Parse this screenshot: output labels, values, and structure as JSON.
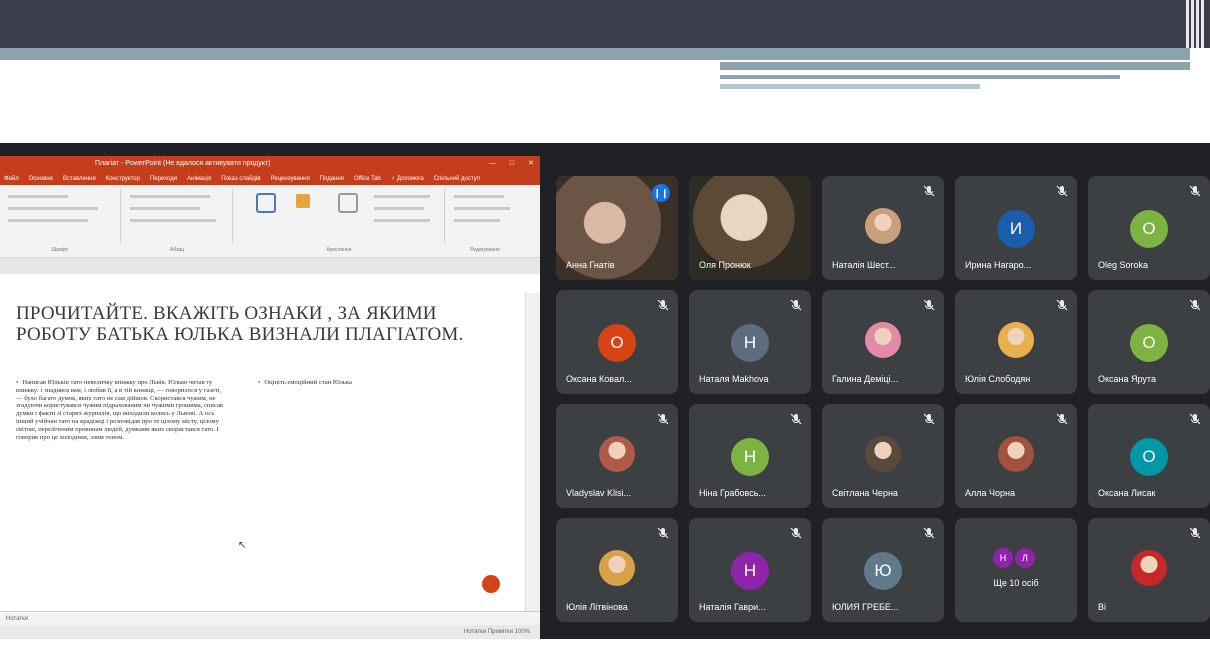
{
  "ppt": {
    "window_title": "Плагіат - PowerPoint (Не вдалося активувати продукт)",
    "tabs": [
      "Файл",
      "Основне",
      "Вставлення",
      "Конструктор",
      "Переходи",
      "Анімація",
      "Показ слайдів",
      "Рецензування",
      "Подання",
      "Office Tab",
      "♀ Допомога",
      "Спільний доступ"
    ],
    "ribbon_groups": [
      "Шрифт",
      "Абзац",
      "Креслення",
      "Редагування"
    ],
    "slide_heading": "ПРОЧИТАЙТЕ. ВКАЖІТЬ ОЗНАКИ , ЗА ЯКИМИ РОБОТУ БАТЬКА ЮЛЬКА ВИЗНАЛИ ПЛАГІАТОМ.",
    "bullet_left": "Написав Юльків тато невеличку книжку про Львів. Юлько читав ту книжку: і знадився вам, і любив її, а в тій книжці, — говорилося у газеті, — було багато думок, яких тато не сам дійшов. Скористався чужим, не згадуючи користувався чужим підрахованим чи чужими грошима, списав думки і факти зі старих журналів, що виходили колись у Львові. А ось інший учійчан тато на крадіжці і розповідав про те цілому місту, цілому світові, переліченим провинам людей, думками яких скористався тато. І говорив про це холодним, злим тоном.",
    "bullet_right": "Оцініть емоційний стан Юлька",
    "notes_label": "Нотатки",
    "status_right": "Нотатки  Примітки  100%"
  },
  "participants": [
    {
      "name": "Анна Гнатів",
      "kind": "video",
      "active": true,
      "speaking": true
    },
    {
      "name": "Оля Пронюк",
      "kind": "video",
      "active": false,
      "speaking": false
    },
    {
      "name": "Наталія Шест...",
      "kind": "photo",
      "color": "#c9a07a"
    },
    {
      "name": "Ирина Нагаро...",
      "kind": "letter",
      "letter": "И",
      "color": "#1a5dab"
    },
    {
      "name": "Oleg Soroka",
      "kind": "letter",
      "letter": "O",
      "color": "#7cb342"
    },
    {
      "name": "Оксана Ковал...",
      "kind": "letter",
      "letter": "О",
      "color": "#d84315"
    },
    {
      "name": "Наталя Makhova",
      "kind": "letter",
      "letter": "Н",
      "color": "#5d6d7e"
    },
    {
      "name": "Галина Деміці...",
      "kind": "photo",
      "color": "#e38aa8"
    },
    {
      "name": "Юлія Слободян",
      "kind": "photo",
      "color": "#e8b04c"
    },
    {
      "name": "Оксана Ярута",
      "kind": "letter",
      "letter": "О",
      "color": "#7cb342"
    },
    {
      "name": "Vladyslav Klisi...",
      "kind": "photo",
      "color": "#b05a4a"
    },
    {
      "name": "Ніна Грабовсь...",
      "kind": "letter",
      "letter": "Н",
      "color": "#7cb342"
    },
    {
      "name": "Світлана Черна",
      "kind": "photo",
      "color": "#5a4a3a"
    },
    {
      "name": "Алла Чорна",
      "kind": "photo",
      "color": "#a0523c"
    },
    {
      "name": "Оксана Лисак",
      "kind": "letter",
      "letter": "О",
      "color": "#0097a7"
    },
    {
      "name": "Юлія Літвінова",
      "kind": "photo",
      "color": "#d9a24a"
    },
    {
      "name": "Наталія Гаври...",
      "kind": "letter",
      "letter": "Н",
      "color": "#8e24aa"
    },
    {
      "name": "ЮЛИЯ ГРЕБЕ...",
      "kind": "letter",
      "letter": "Ю",
      "color": "#5f7a8a"
    },
    {
      "name": "Ще 10 осіб",
      "kind": "more",
      "mini": [
        "Н",
        "Л"
      ],
      "mini_colors": [
        "#8e24aa",
        "#8e24aa"
      ]
    },
    {
      "name": "Ві",
      "kind": "photo",
      "color": "#c62828"
    }
  ],
  "colors": {
    "banner": "#3c3d4c",
    "accent": "#8aa3ad",
    "meet_bg": "#202124",
    "tile": "#3c4043",
    "ppt_red": "#c43e1c"
  }
}
